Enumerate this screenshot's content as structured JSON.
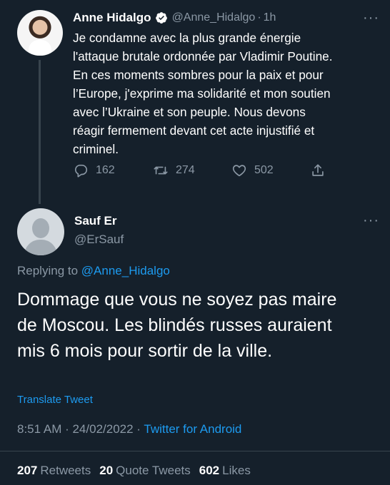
{
  "parent_tweet": {
    "display_name": "Anne Hidalgo",
    "handle": "@Anne_Hidalgo",
    "separator": "·",
    "time": "1h",
    "text_lines": [
      "Je condamne avec la plus grande énergie",
      "l'attaque brutale ordonnée par Vladimir Poutine.",
      "En ces moments sombres pour la paix et pour",
      "l’Europe, j'exprime ma solidarité et mon soutien",
      "avec l’Ukraine et son peuple. Nous devons",
      "réagir fermement devant cet acte injustifié et",
      "criminel."
    ],
    "reply_count": "162",
    "retweet_count": "274",
    "like_count": "502",
    "more": "···"
  },
  "reply_tweet": {
    "display_name": "Sauf Er",
    "handle": "@ErSauf",
    "more": "···",
    "replying_prefix": "Replying to",
    "replying_mention": "@Anne_Hidalgo",
    "text_lines": [
      "Dommage que vous ne soyez pas maire",
      "de Moscou. Les blindés russes auraient",
      "mis 6 mois pour sortir de la ville."
    ],
    "translate_label": "Translate Tweet",
    "timestamp": "8:51 AM · 24/02/2022 ·",
    "client": "Twitter for Android",
    "retweets_count": "207",
    "retweets_label": "Retweets",
    "quote_count": "20",
    "quote_label": "Quote Tweets",
    "likes_count": "602",
    "likes_label": "Likes"
  },
  "colors": {
    "background": "#15202b",
    "secondary_text": "#8b98a5",
    "link_blue": "#1d9bf0",
    "divider": "#38444d"
  },
  "icons": [
    "verified-badge-icon",
    "more-icon",
    "reply-icon",
    "retweet-icon",
    "like-icon",
    "share-icon",
    "avatar-placeholder-icon"
  ]
}
